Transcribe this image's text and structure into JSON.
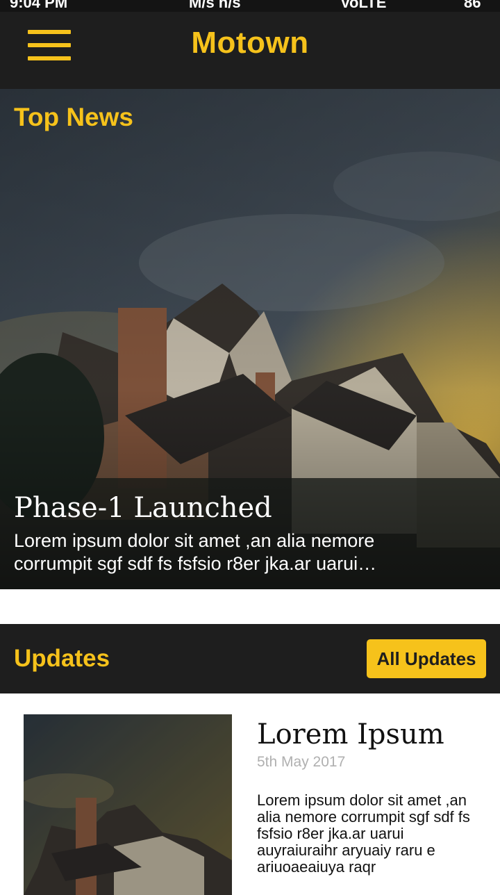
{
  "status_bar": {
    "time": "9:04 PM",
    "network": "M/s h/s",
    "speed": "VoLTE",
    "battery": "86"
  },
  "app_bar": {
    "title": "Motown",
    "menu_icon": "hamburger-menu-icon"
  },
  "top_news": {
    "section_title": "Top News",
    "headline": "Phase-1 Launched",
    "excerpt": "Lorem ipsum dolor sit amet ,an alia nemore corrumpit sgf sdf fs fsfsio r8er jka.ar uarui auyraiuraihr"
  },
  "updates": {
    "section_title": "Updates",
    "all_updates_label": "All Updates",
    "items": [
      {
        "title": "Lorem Ipsum",
        "date": "5th May 2017",
        "body": "Lorem ipsum dolor sit amet ,an alia nemore corrumpit sgf sdf fs fsfsio r8er jka.ar uarui auyraiuraihr aryuaiy raru e ariuoaeaiuya raqr"
      }
    ]
  },
  "colors": {
    "accent": "#f6c21b",
    "bar_background": "#1e1e1e",
    "status_background": "#141414"
  }
}
